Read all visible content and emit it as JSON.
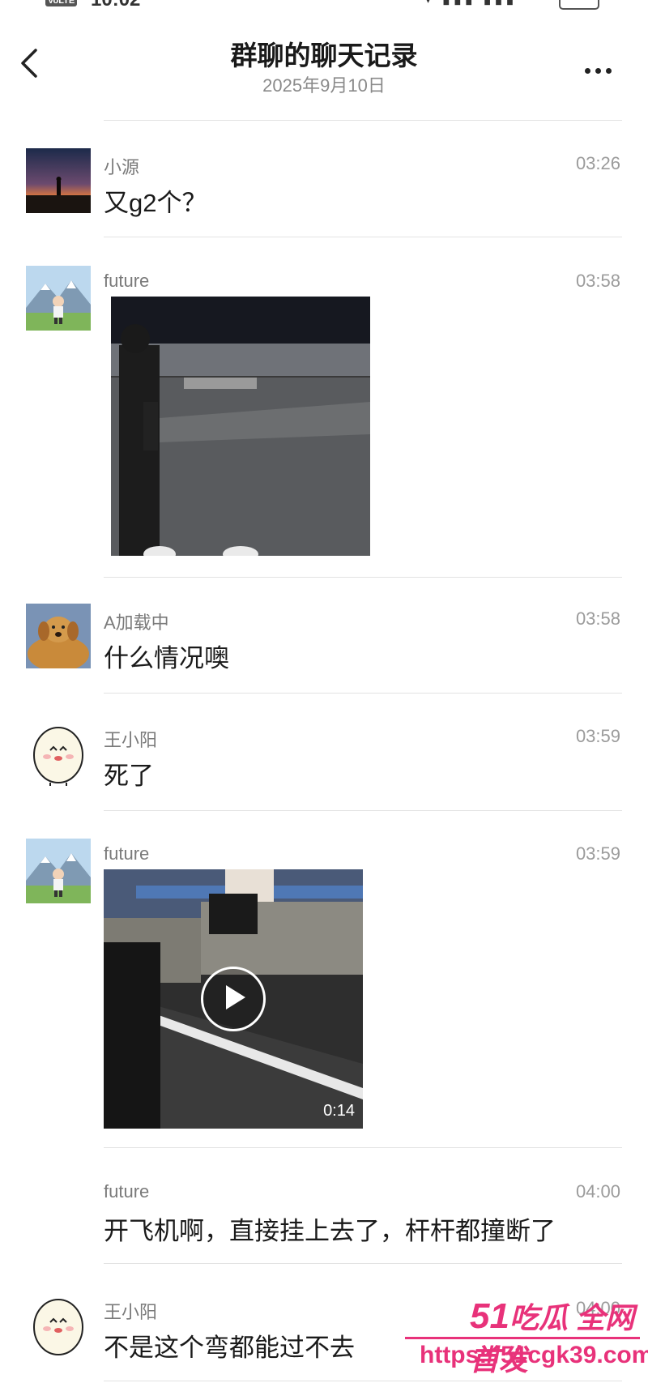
{
  "status_bar": {
    "network_badge": "VoLTE",
    "time": "10:02"
  },
  "header": {
    "title": "群聊的聊天记录",
    "date": "2025年9月10日"
  },
  "messages": [
    {
      "sender": "小源",
      "time": "03:26",
      "text": "又g2个？"
    },
    {
      "sender": "future",
      "time": "03:58",
      "type": "image"
    },
    {
      "sender": "A加载中",
      "time": "03:58",
      "text": "什么情况噢"
    },
    {
      "sender": "王小阳",
      "time": "03:59",
      "text": "死了"
    },
    {
      "sender": "future",
      "time": "03:59",
      "type": "video",
      "duration": "0:14"
    },
    {
      "sender": "future",
      "time": "04:00",
      "text": "开飞机啊，直接挂上去了，杆杆都撞断了"
    },
    {
      "sender": "王小阳",
      "time": "04:00",
      "text": "不是这个弯都能过不去"
    }
  ],
  "watermark": {
    "brand_number": "51",
    "brand_text": "吃瓜 全网首发",
    "url": "https://51cgk39.com"
  },
  "colors": {
    "accent": "#e8327a",
    "divider": "#e3e3e3",
    "meta_text": "#9b9b9b"
  },
  "icons": [
    "back-arrow-icon",
    "more-dots-icon",
    "play-icon"
  ]
}
